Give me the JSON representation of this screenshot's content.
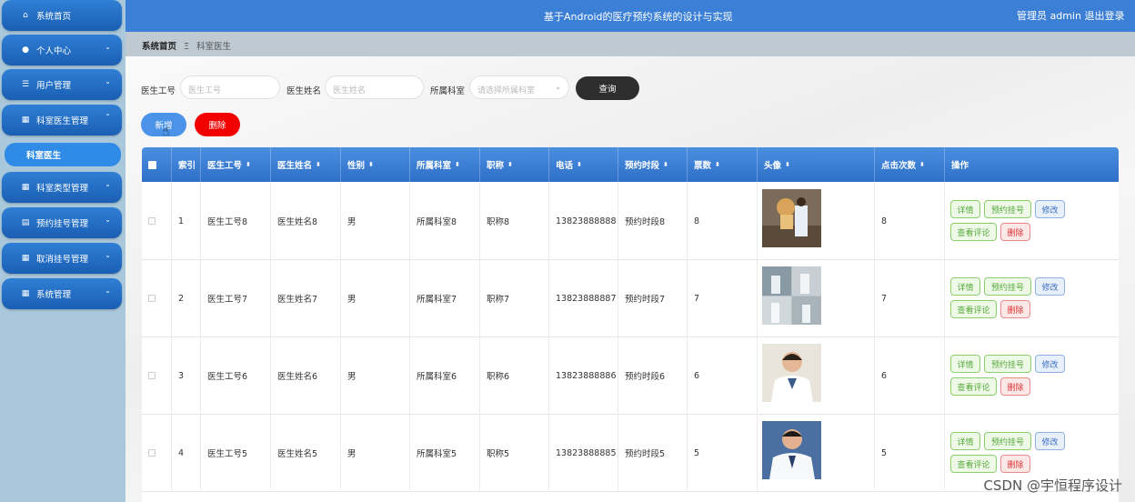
{
  "app": {
    "title": "基于Android的医疗预约系统的设计与实现",
    "admin": "管理员 admin  退出登录"
  },
  "sidebar": {
    "items": [
      {
        "label": "系统首页",
        "icon": "home-icon",
        "glyph": "⌂",
        "chev": ""
      },
      {
        "label": "个人中心",
        "icon": "user-icon",
        "glyph": "●",
        "chev": "⌄"
      },
      {
        "label": "用户管理",
        "icon": "list-icon",
        "glyph": "☰",
        "chev": "⌄"
      },
      {
        "label": "科室医生管理",
        "icon": "id-card-icon",
        "glyph": "▦",
        "chev": "⌃"
      },
      {
        "label": "科室类型管理",
        "icon": "grid-icon",
        "glyph": "▦",
        "chev": "⌄"
      },
      {
        "label": "预约挂号管理",
        "icon": "calendar-icon",
        "glyph": "▤",
        "chev": "⌄"
      },
      {
        "label": "取消挂号管理",
        "icon": "grid-icon",
        "glyph": "▦",
        "chev": "⌄"
      },
      {
        "label": "系统管理",
        "icon": "grid-icon",
        "glyph": "▦",
        "chev": "⌄"
      }
    ],
    "active_sub": "科室医生"
  },
  "breadcrumb": {
    "home": "系统首页",
    "sep": "Ξ",
    "current": "科室医生"
  },
  "search": {
    "fields": [
      {
        "label": "医生工号",
        "placeholder": "医生工号"
      },
      {
        "label": "医生姓名",
        "placeholder": "医生姓名"
      },
      {
        "label": "所属科室",
        "placeholder": "请选择所属科室"
      }
    ],
    "query_label": "查询",
    "add_label": "新增",
    "delete_label": "删除"
  },
  "table": {
    "columns": [
      "索引",
      "医生工号",
      "医生姓名",
      "性别",
      "所属科室",
      "职称",
      "电话",
      "预约时段",
      "票数",
      "头像",
      "点击次数",
      "操作"
    ],
    "sort": "⬍",
    "rows": [
      {
        "index": "1",
        "code": "医生工号8",
        "name": "医生姓名8",
        "gender": "男",
        "dept": "所属科室8",
        "title": "职称8",
        "phone": "13823888888",
        "slot": "预约时段8",
        "tickets": "8",
        "clicks": "8"
      },
      {
        "index": "2",
        "code": "医生工号7",
        "name": "医生姓名7",
        "gender": "男",
        "dept": "所属科室7",
        "title": "职称7",
        "phone": "13823888887",
        "slot": "预约时段7",
        "tickets": "7",
        "clicks": "7"
      },
      {
        "index": "3",
        "code": "医生工号6",
        "name": "医生姓名6",
        "gender": "男",
        "dept": "所属科室6",
        "title": "职称6",
        "phone": "13823888886",
        "slot": "预约时段6",
        "tickets": "6",
        "clicks": "6"
      },
      {
        "index": "4",
        "code": "医生工号5",
        "name": "医生姓名5",
        "gender": "男",
        "dept": "所属科室5",
        "title": "职称5",
        "phone": "13823888885",
        "slot": "预约时段5",
        "tickets": "5",
        "clicks": "5"
      }
    ],
    "actions": {
      "detail": "详情",
      "book": "预约挂号",
      "edit": "修改",
      "review": "查看评论",
      "delete": "删除"
    }
  },
  "watermark": "CSDN @宇恒程序设计",
  "colors": {
    "primary": "#3b7fd6",
    "danger": "#f20000",
    "dark": "#2e2e2e"
  }
}
